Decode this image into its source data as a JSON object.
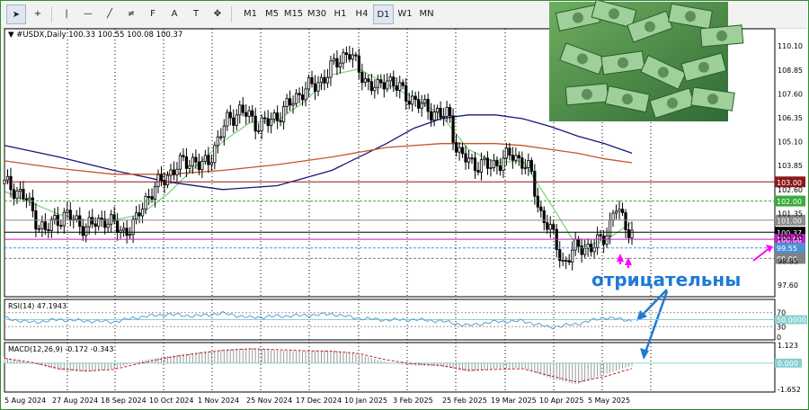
{
  "toolbar": {
    "tools": [
      {
        "name": "cursor-icon",
        "glyph": "➤"
      },
      {
        "name": "crosshair-icon",
        "glyph": "+"
      },
      {
        "name": "vertical-line-icon",
        "glyph": "|"
      },
      {
        "name": "horizontal-line-icon",
        "glyph": "—"
      },
      {
        "name": "trendline-icon",
        "glyph": "╱"
      },
      {
        "name": "equidistant-channel-icon",
        "glyph": "≠"
      },
      {
        "name": "fibonacci-icon",
        "glyph": "F"
      },
      {
        "name": "text-icon",
        "glyph": "A"
      },
      {
        "name": "text-label-icon",
        "glyph": "T"
      },
      {
        "name": "shapes-icon",
        "glyph": "✥"
      }
    ],
    "timeframes": [
      "M1",
      "M5",
      "M15",
      "M30",
      "H1",
      "H4",
      "D1",
      "W1",
      "MN"
    ],
    "active_timeframe": "D1"
  },
  "symbol_label": "▼ #USDX,Daily  100.33 100.55 100.08 100.37",
  "annotation_text": "отрицательны",
  "colors": {
    "candle": "#000000",
    "ma_fast": "#7dd67d",
    "ma_mid": "#17177a",
    "ma_slow": "#c6542a",
    "level_103": "#8b1a1a",
    "level_102": "#3caa3c",
    "level_101": "#8a8a8a",
    "level_100": "#c020c0",
    "level_9955": "#4f8fd6",
    "level_99": "#808080",
    "current_price": "#000000",
    "arrow_magenta": "#ff00ff",
    "arrow_blue": "#1e7ad6",
    "annotation": "#1e7ad6",
    "rsi_line": "#5aa0d6",
    "rsi_level50": "#8ad0d0",
    "macd_signal": "#c02020",
    "macd_hist": "#9a9a9a",
    "macd_zero": "#8ad0d0",
    "grid": "#000000"
  },
  "chart_data": [
    {
      "type": "candlestick",
      "title": "#USDX,Daily",
      "ohlc_last": {
        "open": 100.33,
        "high": 100.55,
        "low": 100.08,
        "close": 100.37
      },
      "x_tick_labels": [
        "5 Aug 2024",
        "27 Aug 2024",
        "18 Sep 2024",
        "10 Oct 2024",
        "1 Nov 2024",
        "25 Nov 2024",
        "17 Dec 2024",
        "10 Jan 2025",
        "3 Feb 2025",
        "25 Feb 2025",
        "19 Mar 2025",
        "10 Apr 2025",
        "5 May 2025"
      ],
      "y_tick_labels": [
        "110.10",
        "108.85",
        "107.60",
        "106.35",
        "105.10",
        "103.85",
        "102.60",
        "101.35",
        "100.10",
        "98.85",
        "97.60"
      ],
      "ylim": [
        97.0,
        111.0
      ],
      "close_path": [
        {
          "x": 0.0,
          "y": 102.9
        },
        {
          "x": 0.4,
          "y": 102.6
        },
        {
          "x": 0.8,
          "y": 102.1
        },
        {
          "x": 1.2,
          "y": 100.9
        },
        {
          "x": 1.5,
          "y": 100.4
        },
        {
          "x": 1.9,
          "y": 101.1
        },
        {
          "x": 2.3,
          "y": 101.2
        },
        {
          "x": 2.7,
          "y": 100.9
        },
        {
          "x": 3.0,
          "y": 100.6
        },
        {
          "x": 3.4,
          "y": 100.9
        },
        {
          "x": 3.7,
          "y": 101.1
        },
        {
          "x": 4.0,
          "y": 100.7
        },
        {
          "x": 4.4,
          "y": 100.4
        },
        {
          "x": 4.8,
          "y": 100.8
        },
        {
          "x": 5.1,
          "y": 102.0
        },
        {
          "x": 5.5,
          "y": 102.6
        },
        {
          "x": 5.9,
          "y": 103.3
        },
        {
          "x": 6.2,
          "y": 103.6
        },
        {
          "x": 6.6,
          "y": 104.1
        },
        {
          "x": 7.0,
          "y": 104.1
        },
        {
          "x": 7.2,
          "y": 103.7
        },
        {
          "x": 7.5,
          "y": 104.2
        },
        {
          "x": 7.8,
          "y": 105.1
        },
        {
          "x": 8.2,
          "y": 106.3
        },
        {
          "x": 8.6,
          "y": 106.7
        },
        {
          "x": 8.9,
          "y": 106.5
        },
        {
          "x": 9.3,
          "y": 106.0
        },
        {
          "x": 9.7,
          "y": 106.1
        },
        {
          "x": 10.1,
          "y": 106.6
        },
        {
          "x": 10.5,
          "y": 107.1
        },
        {
          "x": 11.0,
          "y": 107.9
        },
        {
          "x": 11.4,
          "y": 108.0
        },
        {
          "x": 11.9,
          "y": 108.8
        },
        {
          "x": 12.3,
          "y": 109.4
        },
        {
          "x": 12.6,
          "y": 109.9
        },
        {
          "x": 12.9,
          "y": 109.0
        },
        {
          "x": 13.3,
          "y": 108.2
        },
        {
          "x": 13.7,
          "y": 107.8
        },
        {
          "x": 14.0,
          "y": 108.5
        },
        {
          "x": 14.4,
          "y": 107.9
        },
        {
          "x": 14.8,
          "y": 107.5
        },
        {
          "x": 15.2,
          "y": 107.0
        },
        {
          "x": 15.6,
          "y": 106.8
        },
        {
          "x": 16.0,
          "y": 106.4
        },
        {
          "x": 16.3,
          "y": 106.6
        },
        {
          "x": 16.6,
          "y": 104.5
        },
        {
          "x": 17.0,
          "y": 104.1
        },
        {
          "x": 17.4,
          "y": 103.9
        },
        {
          "x": 17.8,
          "y": 103.8
        },
        {
          "x": 18.2,
          "y": 104.1
        },
        {
          "x": 18.6,
          "y": 104.4
        },
        {
          "x": 19.0,
          "y": 104.1
        },
        {
          "x": 19.3,
          "y": 103.4
        },
        {
          "x": 19.6,
          "y": 101.5
        },
        {
          "x": 19.9,
          "y": 100.8
        },
        {
          "x": 20.2,
          "y": 99.8
        },
        {
          "x": 20.5,
          "y": 98.7
        },
        {
          "x": 20.8,
          "y": 99.3
        },
        {
          "x": 21.1,
          "y": 99.7
        },
        {
          "x": 21.5,
          "y": 99.5
        },
        {
          "x": 21.9,
          "y": 100.0
        },
        {
          "x": 22.2,
          "y": 100.8
        },
        {
          "x": 22.4,
          "y": 101.7
        },
        {
          "x": 22.7,
          "y": 100.9
        },
        {
          "x": 23.0,
          "y": 100.37
        }
      ],
      "moving_averages": [
        {
          "color_key": "ma_fast",
          "points": [
            {
              "x": 0,
              "y": 102.5
            },
            {
              "x": 1,
              "y": 101.9
            },
            {
              "x": 2,
              "y": 101.3
            },
            {
              "x": 3,
              "y": 101.0
            },
            {
              "x": 4,
              "y": 101.0
            },
            {
              "x": 5,
              "y": 101.3
            },
            {
              "x": 6,
              "y": 102.4
            },
            {
              "x": 7,
              "y": 103.8
            },
            {
              "x": 8,
              "y": 105.1
            },
            {
              "x": 9,
              "y": 106.1
            },
            {
              "x": 10,
              "y": 106.2
            },
            {
              "x": 11,
              "y": 107.2
            },
            {
              "x": 12,
              "y": 108.6
            },
            {
              "x": 13,
              "y": 108.9
            },
            {
              "x": 14,
              "y": 108.1
            },
            {
              "x": 15,
              "y": 107.4
            },
            {
              "x": 16,
              "y": 106.5
            },
            {
              "x": 17,
              "y": 104.7
            },
            {
              "x": 18,
              "y": 104.0
            },
            {
              "x": 19,
              "y": 104.1
            },
            {
              "x": 20,
              "y": 101.9
            },
            {
              "x": 21,
              "y": 99.6
            },
            {
              "x": 22,
              "y": 99.9
            },
            {
              "x": 23,
              "y": 100.9
            }
          ]
        },
        {
          "color_key": "ma_mid",
          "points": [
            {
              "x": 0,
              "y": 104.9
            },
            {
              "x": 2,
              "y": 104.3
            },
            {
              "x": 4,
              "y": 103.6
            },
            {
              "x": 6,
              "y": 103.0
            },
            {
              "x": 8,
              "y": 102.6
            },
            {
              "x": 10,
              "y": 102.8
            },
            {
              "x": 12,
              "y": 103.6
            },
            {
              "x": 14,
              "y": 105.0
            },
            {
              "x": 15,
              "y": 105.8
            },
            {
              "x": 16,
              "y": 106.3
            },
            {
              "x": 17,
              "y": 106.5
            },
            {
              "x": 18,
              "y": 106.5
            },
            {
              "x": 19,
              "y": 106.3
            },
            {
              "x": 20,
              "y": 105.9
            },
            {
              "x": 21,
              "y": 105.4
            },
            {
              "x": 22,
              "y": 105.0
            },
            {
              "x": 23,
              "y": 104.5
            }
          ]
        },
        {
          "color_key": "ma_slow",
          "points": [
            {
              "x": 0,
              "y": 104.1
            },
            {
              "x": 2,
              "y": 103.7
            },
            {
              "x": 4,
              "y": 103.4
            },
            {
              "x": 6,
              "y": 103.4
            },
            {
              "x": 8,
              "y": 103.6
            },
            {
              "x": 10,
              "y": 103.9
            },
            {
              "x": 12,
              "y": 104.3
            },
            {
              "x": 14,
              "y": 104.8
            },
            {
              "x": 16,
              "y": 105.0
            },
            {
              "x": 18,
              "y": 105.0
            },
            {
              "x": 19,
              "y": 104.9
            },
            {
              "x": 20,
              "y": 104.7
            },
            {
              "x": 21,
              "y": 104.5
            },
            {
              "x": 22,
              "y": 104.2
            },
            {
              "x": 23,
              "y": 104.0
            }
          ]
        }
      ],
      "horizontal_levels": [
        {
          "value": 103.0,
          "label": "103.00",
          "color_key": "level_103",
          "style": "solid"
        },
        {
          "value": 102.0,
          "label": "102.00",
          "color_key": "level_102",
          "style": "dashed"
        },
        {
          "value": 101.0,
          "label": "101.00",
          "color_key": "level_101",
          "style": "solid"
        },
        {
          "value": 100.37,
          "label": "100.37",
          "color_key": "current_price",
          "style": "solid"
        },
        {
          "value": 100.0,
          "label": "100.00",
          "color_key": "level_100",
          "style": "solid"
        },
        {
          "value": 99.55,
          "label": "99.55",
          "color_key": "level_9955",
          "style": "dashed"
        },
        {
          "value": 99.0,
          "label": "99.00",
          "color_key": "level_99",
          "style": "dashed"
        }
      ]
    },
    {
      "type": "line",
      "title": "RSI(14) 47.1943",
      "y_tick_labels": [
        "70",
        "50.0000",
        "30",
        "0"
      ],
      "ylim": [
        0,
        100
      ],
      "levels": [
        70,
        50,
        30
      ],
      "points": [
        {
          "x": 0,
          "y": 54
        },
        {
          "x": 1,
          "y": 42
        },
        {
          "x": 2,
          "y": 50
        },
        {
          "x": 3,
          "y": 46
        },
        {
          "x": 4,
          "y": 44
        },
        {
          "x": 5,
          "y": 58
        },
        {
          "x": 6,
          "y": 65
        },
        {
          "x": 7,
          "y": 60
        },
        {
          "x": 8,
          "y": 68
        },
        {
          "x": 9,
          "y": 56
        },
        {
          "x": 10,
          "y": 60
        },
        {
          "x": 11,
          "y": 62
        },
        {
          "x": 12,
          "y": 66
        },
        {
          "x": 13,
          "y": 54
        },
        {
          "x": 14,
          "y": 49
        },
        {
          "x": 15,
          "y": 50
        },
        {
          "x": 16,
          "y": 46
        },
        {
          "x": 17,
          "y": 33
        },
        {
          "x": 18,
          "y": 44
        },
        {
          "x": 19,
          "y": 46
        },
        {
          "x": 20,
          "y": 28
        },
        {
          "x": 21,
          "y": 38
        },
        {
          "x": 22,
          "y": 56
        },
        {
          "x": 23,
          "y": 47.19
        }
      ]
    },
    {
      "type": "bar",
      "title": "MACD(12,26,9) -0.172 -0.343",
      "y_tick_labels": [
        "1.123",
        "0.000",
        "-1.652"
      ],
      "ylim": [
        -1.652,
        1.123
      ],
      "histogram": [
        {
          "x": 0,
          "y": 0.35
        },
        {
          "x": 1,
          "y": 0.0
        },
        {
          "x": 2,
          "y": -0.45
        },
        {
          "x": 3,
          "y": -0.55
        },
        {
          "x": 4,
          "y": -0.35
        },
        {
          "x": 5,
          "y": 0.15
        },
        {
          "x": 6,
          "y": 0.45
        },
        {
          "x": 7,
          "y": 0.65
        },
        {
          "x": 8,
          "y": 0.85
        },
        {
          "x": 9,
          "y": 0.95
        },
        {
          "x": 10,
          "y": 0.8
        },
        {
          "x": 11,
          "y": 0.75
        },
        {
          "x": 12,
          "y": 0.8
        },
        {
          "x": 13,
          "y": 0.55
        },
        {
          "x": 14,
          "y": 0.05
        },
        {
          "x": 15,
          "y": -0.15
        },
        {
          "x": 16,
          "y": -0.2
        },
        {
          "x": 17,
          "y": -0.55
        },
        {
          "x": 18,
          "y": -0.35
        },
        {
          "x": 19,
          "y": -0.3
        },
        {
          "x": 20,
          "y": -0.95
        },
        {
          "x": 21,
          "y": -1.35
        },
        {
          "x": 22,
          "y": -0.7
        },
        {
          "x": 23,
          "y": -0.17
        }
      ],
      "signal": [
        {
          "x": 0,
          "y": 0.3
        },
        {
          "x": 1,
          "y": 0.05
        },
        {
          "x": 2,
          "y": -0.35
        },
        {
          "x": 3,
          "y": -0.5
        },
        {
          "x": 4,
          "y": -0.4
        },
        {
          "x": 5,
          "y": 0.0
        },
        {
          "x": 6,
          "y": 0.35
        },
        {
          "x": 7,
          "y": 0.6
        },
        {
          "x": 8,
          "y": 0.8
        },
        {
          "x": 9,
          "y": 0.9
        },
        {
          "x": 10,
          "y": 0.85
        },
        {
          "x": 11,
          "y": 0.78
        },
        {
          "x": 12,
          "y": 0.75
        },
        {
          "x": 13,
          "y": 0.6
        },
        {
          "x": 14,
          "y": 0.2
        },
        {
          "x": 15,
          "y": -0.05
        },
        {
          "x": 16,
          "y": -0.15
        },
        {
          "x": 17,
          "y": -0.45
        },
        {
          "x": 18,
          "y": -0.4
        },
        {
          "x": 19,
          "y": -0.35
        },
        {
          "x": 20,
          "y": -0.8
        },
        {
          "x": 21,
          "y": -1.2
        },
        {
          "x": 22,
          "y": -0.85
        },
        {
          "x": 23,
          "y": -0.34
        }
      ]
    }
  ]
}
